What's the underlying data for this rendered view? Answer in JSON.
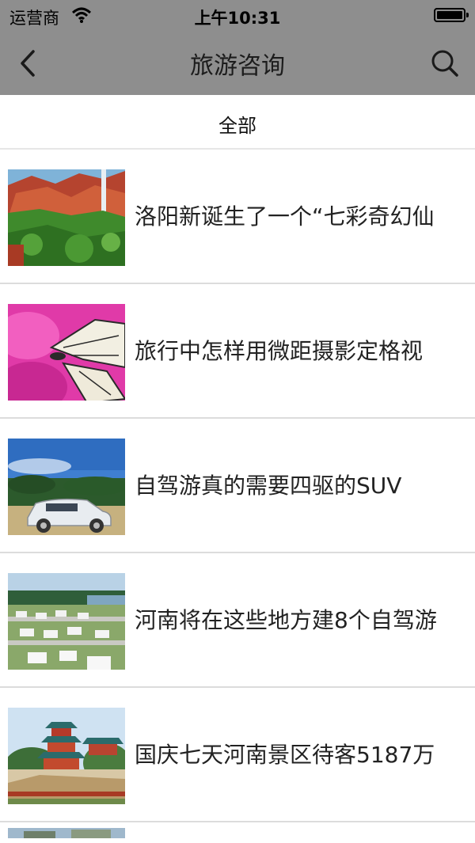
{
  "status_bar": {
    "carrier": "运营商",
    "time": "上午10:31"
  },
  "header": {
    "title": "旅游咨询"
  },
  "filter": {
    "label": "全部"
  },
  "articles": [
    {
      "title": "洛阳新诞生了一个“七彩奇幻仙",
      "thumbnail": "red-cliff-landscape"
    },
    {
      "title": "旅行中怎样用微距摄影定格视",
      "thumbnail": "butterfly-on-pink-flower"
    },
    {
      "title": "自驾游真的需要四驱的SUV",
      "thumbnail": "white-suv"
    },
    {
      "title": "河南将在这些地方建8个自驾游",
      "thumbnail": "rv-campsite"
    },
    {
      "title": "国庆七天河南景区待客5187万",
      "thumbnail": "chinese-pagoda"
    }
  ],
  "colors": {
    "nav_bg": "#8e8e8e",
    "divider": "#dcdcdc"
  }
}
